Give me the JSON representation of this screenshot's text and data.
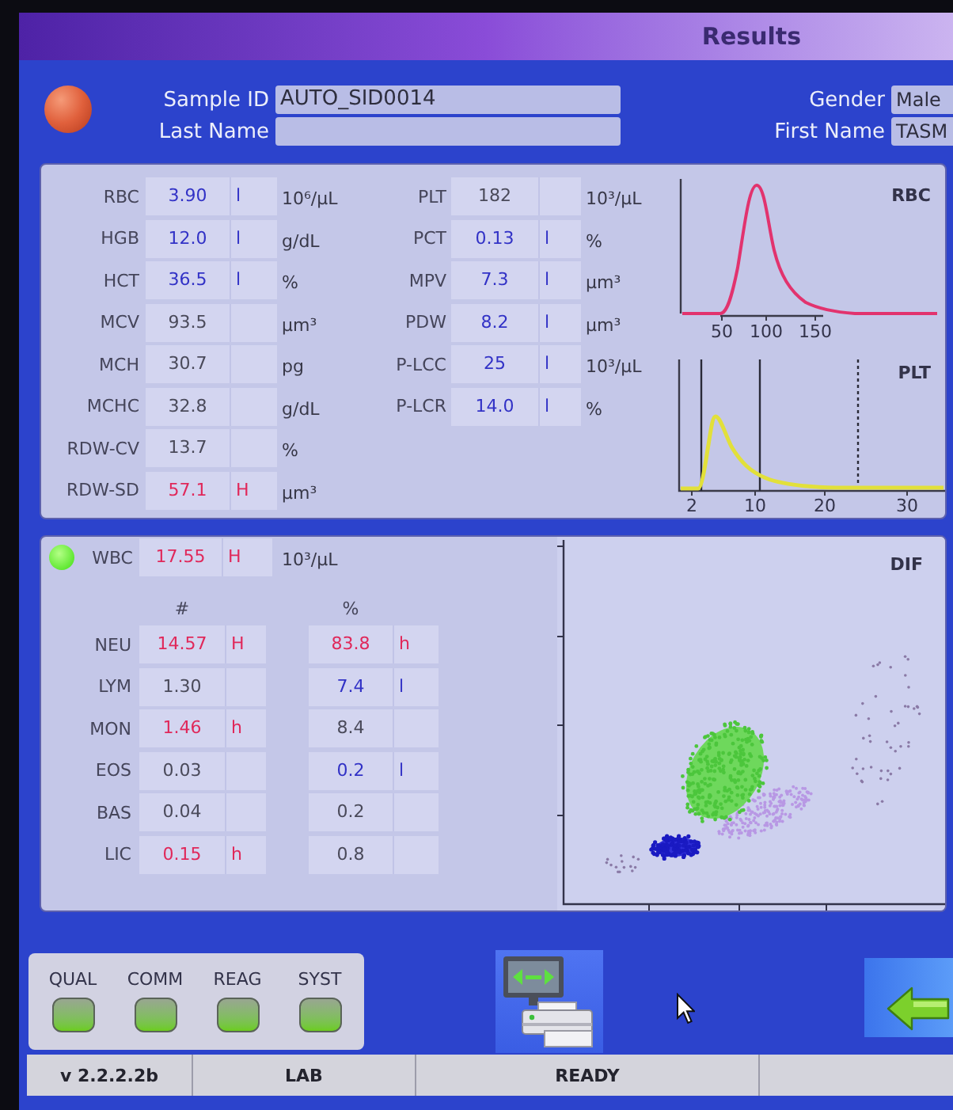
{
  "window": {
    "title": "Results"
  },
  "patient": {
    "left_fields": [
      {
        "label": "Sample ID",
        "value": "AUTO_SID0014"
      },
      {
        "label": "Last Name"
      }
    ],
    "right_fields": [
      {
        "label": "Gender",
        "value": "Male"
      },
      {
        "label": "First Name",
        "value": "TASM"
      }
    ]
  },
  "blood_counts": {
    "left_column": [
      {
        "label": "RBC",
        "value": "3.90",
        "flag": "l",
        "low": true,
        "high": false,
        "unit": "10⁶/µL"
      },
      {
        "label": "HGB",
        "value": "12.0",
        "flag": "l",
        "low": true,
        "high": false,
        "unit": "g/dL"
      },
      {
        "label": "HCT",
        "value": "36.5",
        "flag": "l",
        "low": true,
        "high": false,
        "unit": "%"
      },
      {
        "label": "MCV",
        "value": "93.5",
        "low": false,
        "high": false,
        "unit": "µm³"
      },
      {
        "label": "MCH",
        "value": "30.7",
        "low": false,
        "high": false,
        "unit": "pg"
      },
      {
        "label": "MCHC",
        "value": "32.8",
        "low": false,
        "high": false,
        "unit": "g/dL"
      },
      {
        "label": "RDW-CV",
        "value": "13.7",
        "low": false,
        "high": false,
        "unit": "%"
      },
      {
        "label": "RDW-SD",
        "value": "57.1",
        "flag": "H",
        "low": false,
        "high": true,
        "unit": "µm³"
      }
    ],
    "right_column": [
      {
        "label": "PLT",
        "value": "182",
        "low": false,
        "high": false,
        "unit": "10³/µL"
      },
      {
        "label": "PCT",
        "value": "0.13",
        "flag": "l",
        "low": true,
        "high": false,
        "unit": "%"
      },
      {
        "label": "MPV",
        "value": "7.3",
        "flag": "l",
        "low": true,
        "high": false,
        "unit": "µm³"
      },
      {
        "label": "PDW",
        "value": "8.2",
        "flag": "l",
        "low": true,
        "high": false,
        "unit": "µm³"
      },
      {
        "label": "P-LCC",
        "value": "25",
        "flag": "l",
        "low": true,
        "high": false,
        "unit": "10³/µL"
      },
      {
        "label": "P-LCR",
        "value": "14.0",
        "flag": "l",
        "low": true,
        "high": false,
        "unit": "%"
      }
    ]
  },
  "histograms": [
    {
      "kind": "rbc",
      "title": "RBC",
      "x_tick_labels": [
        "50",
        "100",
        "150"
      ]
    },
    {
      "kind": "plt",
      "title": "PLT",
      "x_tick_labels": [
        "2",
        "10",
        "20",
        "30"
      ]
    }
  ],
  "wbc": {
    "label": "WBC",
    "value": "17.55",
    "flag": "H",
    "low": false,
    "high": true,
    "unit": "10³/µL"
  },
  "differential": {
    "column_headers": [
      "#",
      "%"
    ],
    "rows": [
      {
        "label": "NEU",
        "count": {
          "value": "14.57",
          "flag": "H",
          "low": false,
          "high": true
        },
        "percent": {
          "value": "83.8",
          "flag": "h",
          "low": false,
          "high": true
        }
      },
      {
        "label": "LYM",
        "count": {
          "value": "1.30",
          "low": false,
          "high": false
        },
        "percent": {
          "value": "7.4",
          "flag": "l",
          "low": true,
          "high": false
        }
      },
      {
        "label": "MON",
        "count": {
          "value": "1.46",
          "flag": "h",
          "low": false,
          "high": true
        },
        "percent": {
          "value": "8.4",
          "low": false,
          "high": false
        }
      },
      {
        "label": "EOS",
        "count": {
          "value": "0.03",
          "low": false,
          "high": false
        },
        "percent": {
          "value": "0.2",
          "flag": "l",
          "low": true,
          "high": false
        }
      },
      {
        "label": "BAS",
        "count": {
          "value": "0.04",
          "low": false,
          "high": false
        },
        "percent": {
          "value": "0.2",
          "low": false,
          "high": false
        }
      },
      {
        "label": "LIC",
        "count": {
          "value": "0.15",
          "flag": "h",
          "low": false,
          "high": true
        },
        "percent": {
          "value": "0.8",
          "low": false,
          "high": false
        }
      }
    ]
  },
  "scatter_plot": {
    "title": "DIF"
  },
  "indicators": [
    {
      "label": "QUAL",
      "on": true
    },
    {
      "label": "COMM",
      "on": true
    },
    {
      "label": "REAG",
      "on": true
    },
    {
      "label": "SYST",
      "on": true
    }
  ],
  "status_bar": {
    "cells": [
      "v 2.2.2.2b",
      "LAB",
      "READY"
    ]
  }
}
